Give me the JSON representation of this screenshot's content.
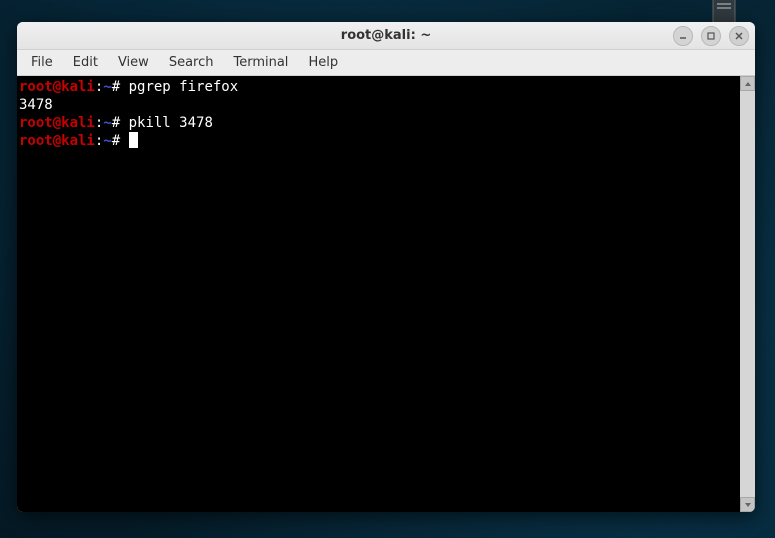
{
  "window": {
    "title": "root@kali: ~"
  },
  "menu": {
    "file": "File",
    "edit": "Edit",
    "view": "View",
    "search": "Search",
    "terminal": "Terminal",
    "help": "Help"
  },
  "prompt": {
    "user_host": "root@kali",
    "separator": ":",
    "path": "~",
    "symbol": "#"
  },
  "lines": [
    {
      "type": "cmd",
      "text": "pgrep firefox"
    },
    {
      "type": "out",
      "text": "3478"
    },
    {
      "type": "cmd",
      "text": "pkill 3478"
    },
    {
      "type": "cursor",
      "text": ""
    }
  ]
}
